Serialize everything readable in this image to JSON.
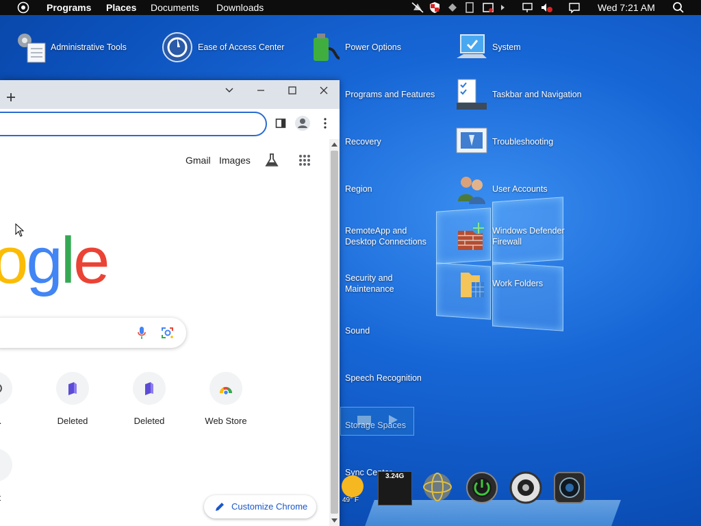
{
  "menubar": {
    "items": [
      "Programs",
      "Places",
      "Documents",
      "Downloads"
    ],
    "clock": "Wed 7:21 AM"
  },
  "desktop": {
    "col1": [
      {
        "label": "Administrative Tools",
        "icon": "admin-tools-icon"
      }
    ],
    "col2": [
      {
        "label": "Ease of Access Center",
        "icon": "ease-of-access-icon"
      }
    ],
    "col3": [
      {
        "label": "Power Options",
        "icon": "power-options-icon"
      },
      {
        "label": "Programs and Features"
      },
      {
        "label": "Recovery"
      },
      {
        "label": "Region"
      },
      {
        "label": "RemoteApp and Desktop Connections"
      },
      {
        "label": "Security and Maintenance"
      },
      {
        "label": "Sound"
      },
      {
        "label": "Speech Recognition"
      },
      {
        "label": "Storage Spaces"
      },
      {
        "label": "Sync Center"
      }
    ],
    "col4": [
      {
        "label": "System",
        "icon": "system-icon"
      },
      {
        "label": "Taskbar and Navigation",
        "icon": "taskbar-icon"
      },
      {
        "label": "Troubleshooting",
        "icon": "troubleshooting-icon"
      },
      {
        "label": "User Accounts",
        "icon": "user-accounts-icon"
      },
      {
        "label": "Windows Defender Firewall",
        "icon": "firewall-icon"
      },
      {
        "label": "Work Folders",
        "icon": "work-folders-icon"
      }
    ]
  },
  "chrome": {
    "top_links": [
      "Gmail",
      "Images"
    ],
    "logo_text": "ogle",
    "shortcuts": [
      {
        "label": "Deskto..."
      },
      {
        "label": "Deleted"
      },
      {
        "label": "Deleted"
      },
      {
        "label": "Web Store"
      },
      {
        "label": "Shortcut"
      }
    ],
    "shortcut_labels_visible": [
      "sktо...",
      "Deleted",
      "Deleted",
      "Web Store",
      "ortcut"
    ],
    "customize_label": "Customize Chrome"
  },
  "dock": {
    "memory": "3.24G",
    "weather": "49° F"
  },
  "colors": {
    "google_blue": "#4285f4",
    "google_red": "#ea4335",
    "google_yellow": "#fbbc05",
    "google_green": "#34a853",
    "chrome_accent": "#1a57c9"
  }
}
